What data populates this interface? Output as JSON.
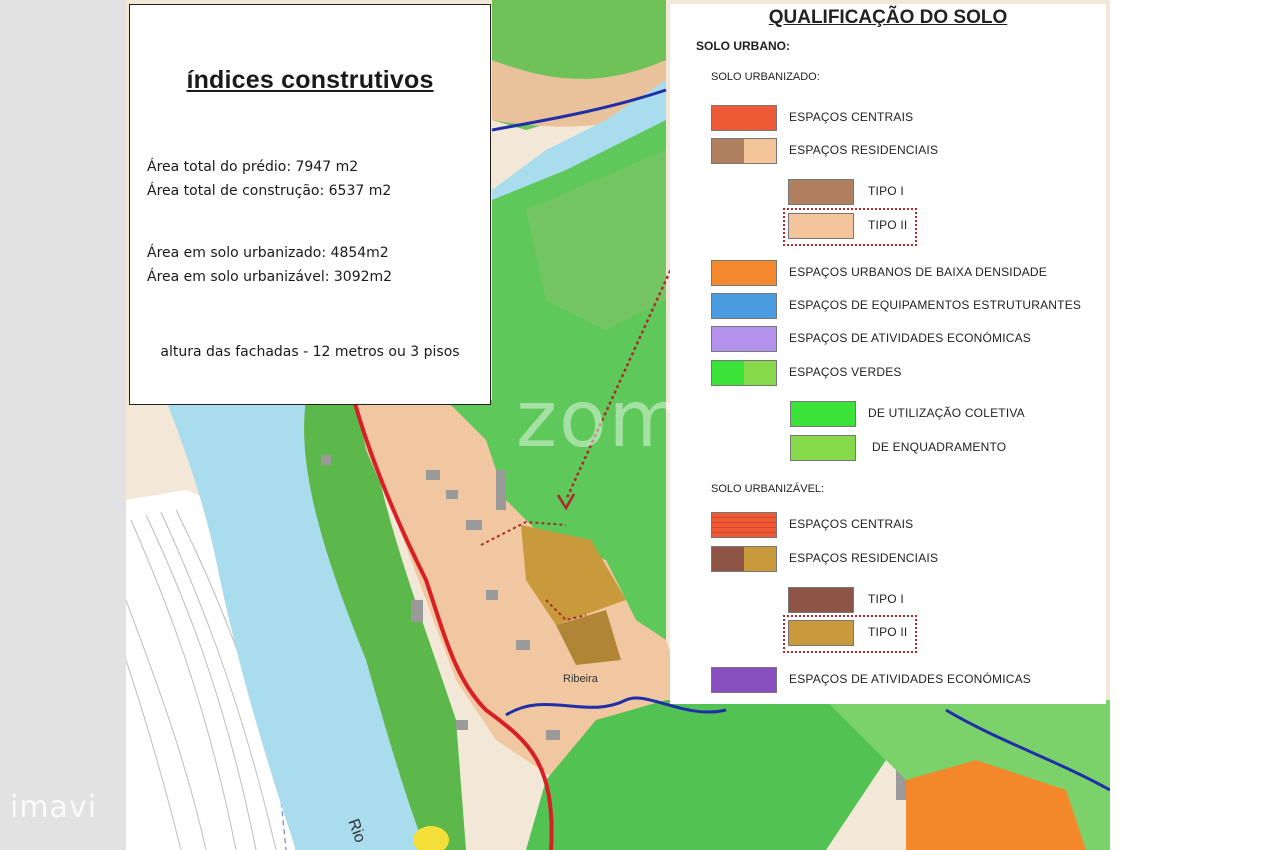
{
  "info_box": {
    "title": "índices construtivos",
    "area_predio": "Área total do prédio: 7947 m2",
    "area_construcao": "Área total de construção: 6537 m2",
    "area_urbanizado": "Área em solo urbanizado: 4854m2",
    "area_urbanizavel": "Área em solo urbanizável: 3092m2",
    "altura": "altura das fachadas - 12 metros ou 3 pisos"
  },
  "legend": {
    "title": "QUALIFICAÇÃO DO SOLO",
    "solo_urbano": "SOLO URBANO:",
    "solo_urbanizado": "SOLO URBANIZADO:",
    "urbanizado_items": {
      "espacos_centrais": {
        "label": "ESPAÇOS CENTRAIS",
        "color": "#ef5a36"
      },
      "espacos_residenciais": {
        "label": "ESPAÇOS RESIDENCIAIS",
        "colors": [
          "#b07f60",
          "#f4c49a"
        ]
      },
      "tipo_i": {
        "label": "TIPO I",
        "color": "#b07f60"
      },
      "tipo_ii": {
        "label": "TIPO II",
        "color": "#f4c49a"
      },
      "baixa_densidade": {
        "label": "ESPAÇOS URBANOS DE BAIXA DENSIDADE",
        "color": "#f5892f"
      },
      "equipamentos": {
        "label": "ESPAÇOS DE EQUIPAMENTOS ESTRUTURANTES",
        "color": "#4a9be0"
      },
      "atividades": {
        "label": "ESPAÇOS DE ATIVIDADES ECONÓMICAS",
        "color": "#b393ec"
      },
      "verdes": {
        "label": "ESPAÇOS VERDES",
        "colors": [
          "#3be23a",
          "#86d94a"
        ]
      },
      "utilizacao_coletiva": {
        "label": "DE UTILIZAÇÃO COLETIVA",
        "color": "#3be23a"
      },
      "enquadramento": {
        "label": "DE ENQUADRAMENTO",
        "color": "#86d94a"
      }
    },
    "solo_urbanizavel": "SOLO URBANIZÁVEL:",
    "urbanizavel_items": {
      "espacos_centrais": {
        "label": "ESPAÇOS CENTRAIS",
        "color": "#ef5a36"
      },
      "espacos_residenciais": {
        "label": "ESPAÇOS RESIDENCIAIS",
        "colors": [
          "#8e5446",
          "#c99a3b"
        ]
      },
      "tipo_i": {
        "label": "TIPO I",
        "color": "#8e5446"
      },
      "tipo_ii": {
        "label": "TIPO II",
        "color": "#c99a3b"
      },
      "atividades": {
        "label": "ESPAÇOS DE ATIVIDADES ECONÓMICAS",
        "color": "#8a4fbf"
      }
    }
  },
  "map": {
    "place_label": "Ribeira",
    "river_label": "Rio",
    "overlay_text": "zome"
  },
  "watermark": "imavi"
}
